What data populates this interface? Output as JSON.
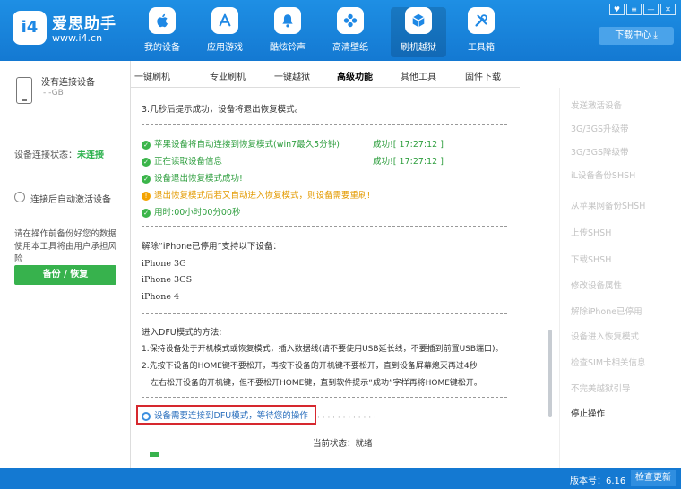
{
  "app": {
    "logo_text": "i4",
    "name": "爱思助手",
    "url": "www.i4.cn"
  },
  "nav": [
    {
      "label": "我的设备",
      "icon": "apple-icon"
    },
    {
      "label": "应用游戏",
      "icon": "app-store-icon"
    },
    {
      "label": "酷炫铃声",
      "icon": "bell-icon"
    },
    {
      "label": "高清壁纸",
      "icon": "flower-icon"
    },
    {
      "label": "刷机越狱",
      "icon": "box-icon"
    },
    {
      "label": "工具箱",
      "icon": "tools-icon"
    }
  ],
  "window_buttons": {
    "skin": "♥",
    "menu": "≡",
    "minimize": "—",
    "close": "✕"
  },
  "download_center": "下载中心",
  "tabs": [
    "一键刷机",
    "专业刷机",
    "一键越狱",
    "高级功能",
    "其他工具",
    "固件下载"
  ],
  "sidebar": {
    "device_name": "没有连接设备",
    "device_sub": "- -GB",
    "conn_label": "设备连接状态：",
    "conn_value": "未连接",
    "auto_activate": "连接后自动激活设备",
    "tip": "请在操作前备份好您的数据使用本工具将由用户承担风险",
    "backup_button": "备份 / 恢复"
  },
  "content": {
    "step3": "3.几秒后提示成功，设备将退出恢复模式。",
    "log": [
      {
        "type": "ok",
        "text": "苹果设备将自动连接到恢复模式(win7最久5分钟)",
        "status": "成功![ 17:27:12 ]"
      },
      {
        "type": "ok",
        "text": "正在读取设备信息",
        "status": "成功![ 17:27:12 ]"
      },
      {
        "type": "ok",
        "text": "设备退出恢复模式成功!",
        "status": ""
      },
      {
        "type": "warn",
        "text": "退出恢复模式后若又自动进入恢复模式，则设备需要重刷!",
        "status": ""
      },
      {
        "type": "ok",
        "text": "用时:00小时00分00秒",
        "status": ""
      }
    ],
    "support_title": "解除“iPhone已停用”支持以下设备：",
    "devices": [
      "iPhone 3G",
      "iPhone 3GS",
      "iPhone 4"
    ],
    "dfu_title": "进入DFU模式的方法:",
    "dfu_steps": [
      "1.保持设备处于开机模式或恢复模式，插入数据线(请不要使用USB延长线，不要插到前置USB端口)。",
      "2.先按下设备的HOME键不要松开，再按下设备的开机键不要松开，直到设备屏幕熄灭再过4秒",
      "左右松开设备的开机键，但不要松开HOME键，直到软件提示“成功”字样再将HOME键松开。"
    ],
    "waiting": "设备需要连接到DFU模式，等待您的操作",
    "status_label": "当前状态：",
    "status_value": "就绪"
  },
  "right_panel": [
    "发送激活设备",
    "3G/3GS升级带",
    "3G/3GS降级带",
    "iL设备备份SHSH",
    "从苹果网备份SHSH",
    "上传SHSH",
    "下载SHSH",
    "修改设备属性",
    "解除iPhone已停用",
    "设备进入恢复模式",
    "检查SIM卡相关信息",
    "不完美越狱引导",
    "停止操作"
  ],
  "footer": {
    "version_label": "版本号：",
    "version_value": "6.16",
    "update_button": "检查更新"
  }
}
